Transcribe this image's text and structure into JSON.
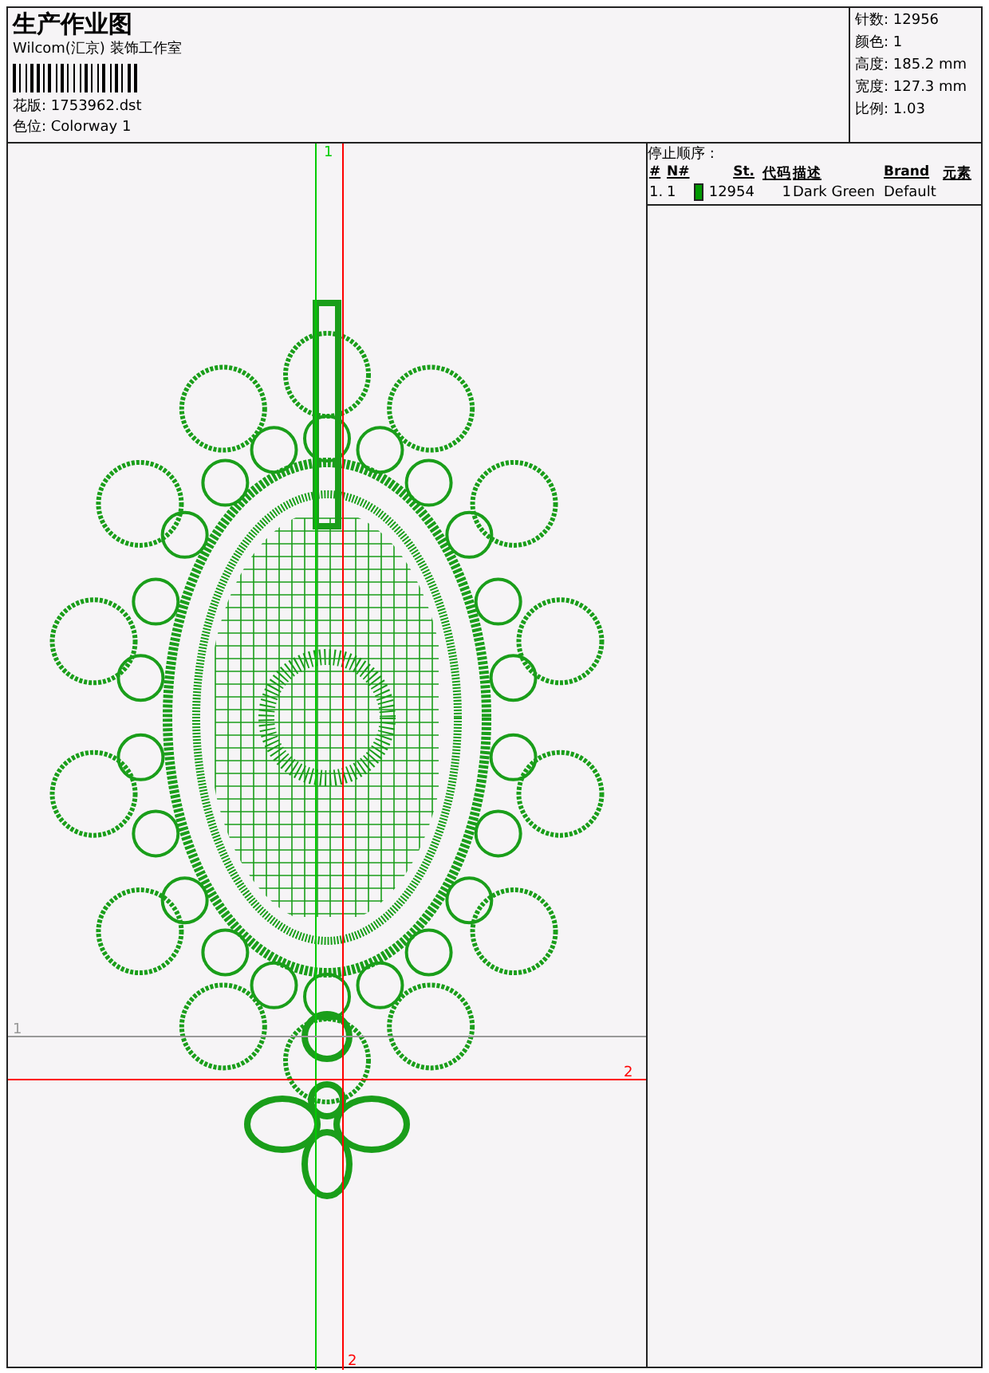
{
  "header": {
    "title": "生产作业图",
    "company": "Wilcom(汇京) 装饰工作室",
    "design_file": "花版: 1753962.dst",
    "colorway": "色位: Colorway 1"
  },
  "stats": [
    "针数: 12956",
    "颜色: 1",
    "高度: 185.2 mm",
    "宽度: 127.3 mm",
    "比例: 1.03"
  ],
  "vertical_guides": [
    {
      "label": "1",
      "color": "#00cc00"
    },
    {
      "label": "2",
      "color": "#ff0000"
    }
  ],
  "horizontal_guides": [
    {
      "label": "1",
      "color": "#999999"
    },
    {
      "label": "2",
      "color": "#ff0000"
    }
  ],
  "stop_sequence": {
    "title": "停止顺序 :",
    "columns": [
      "#",
      "N#",
      "St.",
      "代码",
      "描述",
      "Brand",
      "元素"
    ],
    "rows": [
      {
        "cells": [
          "1.",
          "1",
          "12954",
          "1",
          "Dark Green",
          "Default"
        ],
        "color": "#009900"
      }
    ]
  }
}
